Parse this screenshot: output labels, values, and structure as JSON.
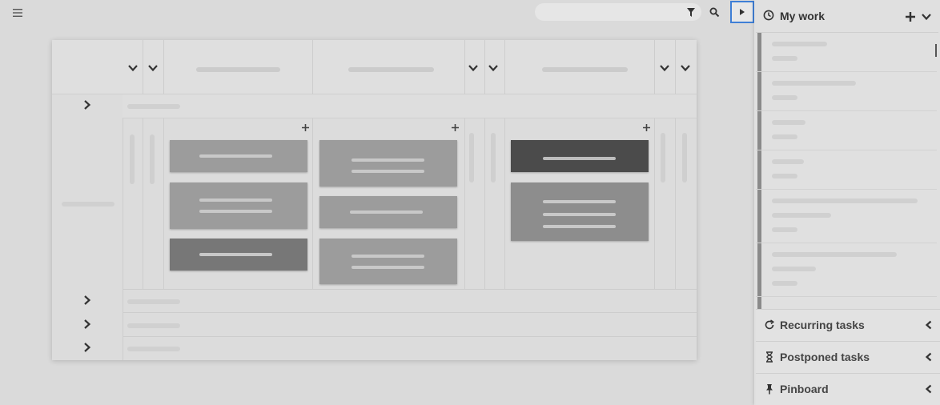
{
  "icons": {
    "menu": "hamburger-menu-icon",
    "filter": "filter-icon",
    "search": "search-icon",
    "toggle": "caret-right-icon",
    "clock": "clock-icon",
    "add": "plus-icon",
    "expand": "chevron-down-icon",
    "recurring": "refresh-icon",
    "postponed": "hourglass-icon",
    "pinboard": "pin-icon",
    "collapse": "chevron-left-icon"
  },
  "colors": {
    "focus_outline": "#3f7fd6",
    "background": "#dadada"
  },
  "sidebar": {
    "title": "My work",
    "sections": [
      {
        "label": "Recurring tasks"
      },
      {
        "label": "Postponed tasks"
      },
      {
        "label": "Pinboard"
      }
    ]
  }
}
